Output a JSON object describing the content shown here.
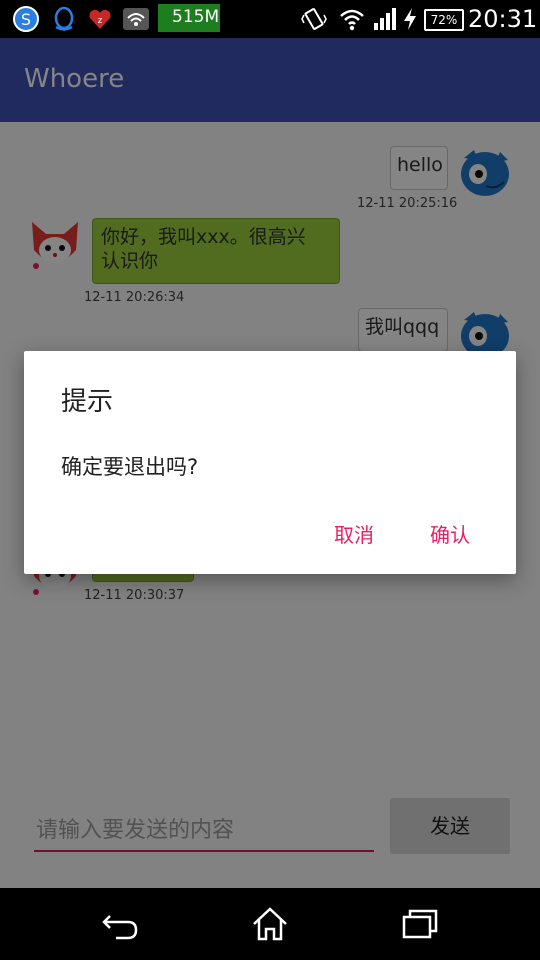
{
  "status_bar": {
    "memory": "515M",
    "battery": "72%",
    "time": "20:31",
    "icons": [
      "sogou-icon",
      "qq-icon",
      "heart-icon",
      "wifi-settings-icon",
      "vibrate-icon",
      "wifi-icon",
      "signal-icon",
      "charging-icon",
      "battery-icon"
    ]
  },
  "app_bar": {
    "title": "Whoere"
  },
  "chat": {
    "messages": [
      {
        "side": "right",
        "text": "hello",
        "time": "12-11 20:25:16"
      },
      {
        "side": "left",
        "text_line1": "你好，我叫xxx。很高兴",
        "text_line2": "认识你",
        "time": "12-11 20:26:34"
      },
      {
        "side": "right",
        "text": "我叫qqq",
        "time": ""
      },
      {
        "side": "left",
        "text": "",
        "time": "12-11 20:30:37"
      }
    ]
  },
  "input": {
    "placeholder": "请输入要发送的内容",
    "send_label": "发送"
  },
  "dialog": {
    "title": "提示",
    "message": "确定要退出吗?",
    "cancel_label": "取消",
    "confirm_label": "确认"
  },
  "colors": {
    "status_bar": "#000000",
    "app_bar": "#3f51b5",
    "accent": "#e91e63",
    "left_bubble": "#9bce3c"
  },
  "nav_bar": {
    "icons": [
      "back-icon",
      "home-icon",
      "recents-icon"
    ]
  }
}
